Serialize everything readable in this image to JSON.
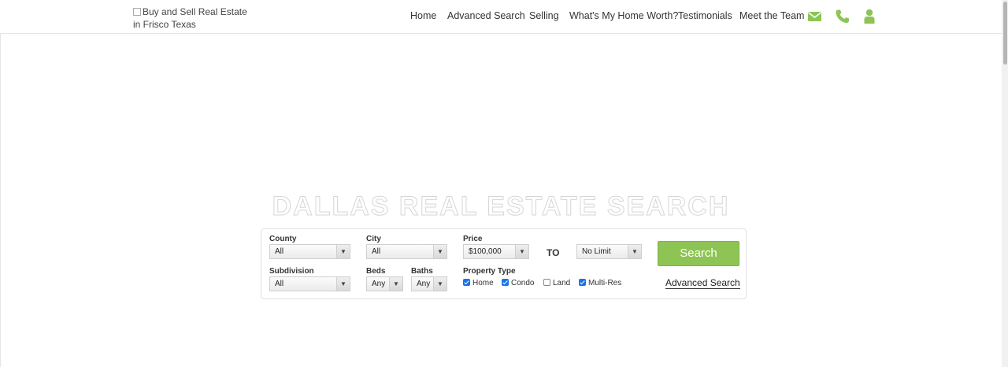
{
  "header": {
    "logo_alt": "Buy and Sell Real Estate in Frisco Texas",
    "nav": [
      "Home",
      "Advanced Search",
      "Selling",
      "What's My Home Worth?",
      "Testimonials",
      "Meet the Team"
    ],
    "icons": [
      "envelope-icon",
      "phone-icon",
      "user-icon"
    ],
    "accent": "#8dc454"
  },
  "hero": {
    "title": "DALLAS REAL ESTATE SEARCH"
  },
  "search": {
    "county": {
      "label": "County",
      "value": "All"
    },
    "city": {
      "label": "City",
      "value": "All"
    },
    "price": {
      "label": "Price",
      "min": "$100,000",
      "to": "TO",
      "max": "No Limit"
    },
    "subdivision": {
      "label": "Subdivision",
      "value": "All"
    },
    "beds": {
      "label": "Beds",
      "value": "Any"
    },
    "baths": {
      "label": "Baths",
      "value": "Any"
    },
    "property_type": {
      "label": "Property Type",
      "options": [
        {
          "label": "Home",
          "checked": true
        },
        {
          "label": "Condo",
          "checked": true
        },
        {
          "label": "Land",
          "checked": false
        },
        {
          "label": "Multi-Res",
          "checked": true
        }
      ]
    },
    "search_button": "Search",
    "advanced_link": "Advanced Search"
  }
}
